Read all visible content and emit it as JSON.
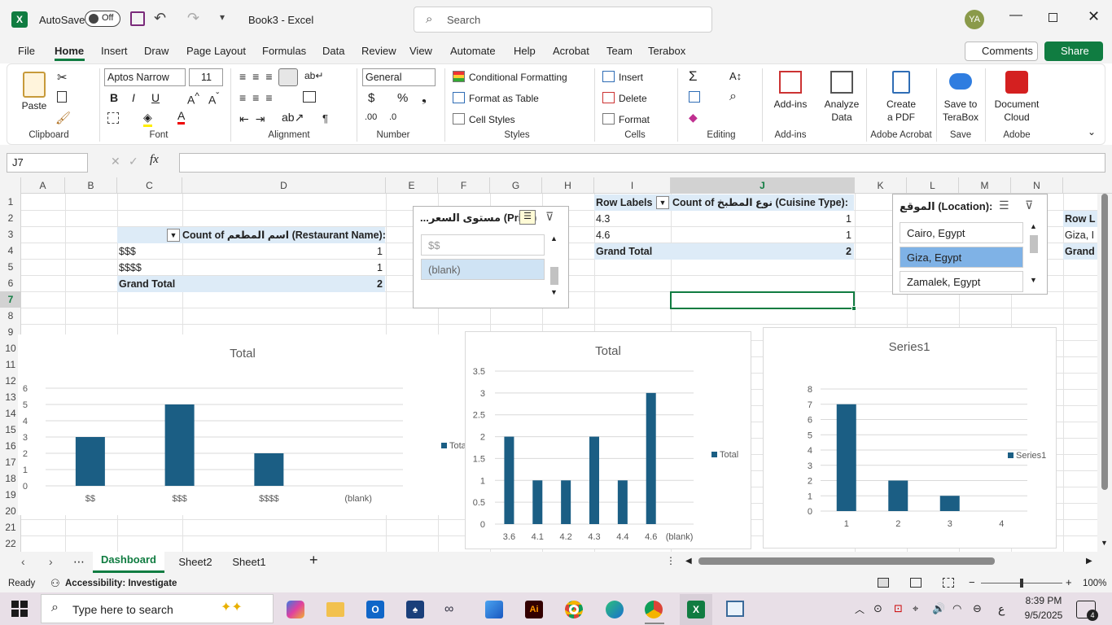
{
  "titlebar": {
    "autosave_label": "AutoSave",
    "autosave_state": "Off",
    "doc_title": "Book3  -  Excel",
    "search_placeholder": "Search",
    "user_initials": "YA"
  },
  "tabs": [
    "File",
    "Home",
    "Insert",
    "Draw",
    "Page Layout",
    "Formulas",
    "Data",
    "Review",
    "View",
    "Automate",
    "Help",
    "Acrobat",
    "Team",
    "Terabox"
  ],
  "ribbon_right": {
    "comments": "Comments",
    "share": "Share"
  },
  "ribbon": {
    "clipboard": {
      "paste": "Paste",
      "group": "Clipboard"
    },
    "font": {
      "name": "Aptos Narrow",
      "size": "11",
      "group": "Font"
    },
    "alignment": {
      "group": "Alignment"
    },
    "number": {
      "format": "General",
      "group": "Number"
    },
    "styles": {
      "cond": "Conditional Formatting",
      "table": "Format as Table",
      "cell": "Cell Styles",
      "group": "Styles"
    },
    "cells": {
      "insert": "Insert",
      "delete": "Delete",
      "format": "Format",
      "group": "Cells"
    },
    "editing": {
      "group": "Editing"
    },
    "addins": {
      "label": "Add-ins",
      "group": "Add-ins"
    },
    "analyze": {
      "l1": "Analyze",
      "l2": "Data"
    },
    "acrobat": {
      "l1": "Create",
      "l2": "a PDF",
      "group": "Adobe Acrobat"
    },
    "terabox": {
      "l1": "Save to",
      "l2": "TeraBox",
      "group": "Save"
    },
    "adobe": {
      "l1": "Document",
      "l2": "Cloud",
      "group": "Adobe"
    }
  },
  "formula_bar": {
    "name_box": "J7",
    "fx": "fx",
    "value": ""
  },
  "columns": [
    "A",
    "B",
    "C",
    "D",
    "E",
    "F",
    "G",
    "H",
    "I",
    "J",
    "K",
    "L",
    "M",
    "N"
  ],
  "rows": [
    "1",
    "2",
    "3",
    "4",
    "5",
    "6",
    "7",
    "8",
    "9",
    "10",
    "11",
    "12",
    "13",
    "14",
    "15",
    "16",
    "17",
    "18",
    "19",
    "20",
    "21",
    "22"
  ],
  "pivot1": {
    "header": "Count of اسم المطعم (Restaurant Name):",
    "rows": [
      {
        "label": "$$$",
        "value": "1"
      },
      {
        "label": "$$$$",
        "value": "1"
      }
    ],
    "total_label": "Grand Total",
    "total_value": "2"
  },
  "pivot2": {
    "row_labels": "Row Labels",
    "header": "Count of نوع المطبخ (Cuisine Type):",
    "rows": [
      {
        "label": "4.3",
        "value": "1"
      },
      {
        "label": "4.6",
        "value": "1"
      }
    ],
    "total_label": "Grand Total",
    "total_value": "2"
  },
  "pivot3": {
    "row_labels": "Row L",
    "row1": "Giza, I",
    "total": "Grand"
  },
  "slicer_price": {
    "title": "...مستوى السعر (Price)",
    "items": [
      "$$",
      "(blank)"
    ]
  },
  "slicer_location": {
    "title": "الموقع (Location):",
    "items": [
      "Cairo, Egypt",
      "Giza, Egypt",
      "Zamalek, Egypt"
    ]
  },
  "chart_data": [
    {
      "type": "bar",
      "title": "Total",
      "categories": [
        "$$",
        "$$$",
        "$$$$",
        "(blank)"
      ],
      "series": [
        {
          "name": "Total",
          "values": [
            3,
            5,
            2,
            0
          ]
        }
      ],
      "ylim": [
        0,
        6
      ],
      "yticks": [
        "0",
        "1",
        "2",
        "3",
        "4",
        "5",
        "6"
      ],
      "legend": "right",
      "color": "#1b5e84"
    },
    {
      "type": "bar",
      "title": "Total",
      "categories": [
        "3.6",
        "4.1",
        "4.2",
        "4.3",
        "4.4",
        "4.6",
        "(blank)"
      ],
      "series": [
        {
          "name": "Total",
          "values": [
            2,
            1,
            1,
            2,
            1,
            3,
            0
          ]
        }
      ],
      "ylim": [
        0,
        3.5
      ],
      "yticks": [
        "0",
        "0.5",
        "1",
        "1.5",
        "2",
        "2.5",
        "3",
        "3.5"
      ],
      "legend": "right",
      "color": "#1b5e84"
    },
    {
      "type": "bar",
      "title": "Series1",
      "categories": [
        "1",
        "2",
        "3",
        "4"
      ],
      "series": [
        {
          "name": "Series1",
          "values": [
            7,
            2,
            1,
            0
          ]
        }
      ],
      "ylim": [
        0,
        8
      ],
      "yticks": [
        "0",
        "1",
        "2",
        "3",
        "4",
        "5",
        "6",
        "7",
        "8"
      ],
      "legend": "right",
      "color": "#1b5e84"
    }
  ],
  "sheets": [
    "Dashboard",
    "Sheet2",
    "Sheet1"
  ],
  "status": {
    "ready": "Ready",
    "accessibility": "Accessibility: Investigate",
    "zoom": "100%"
  },
  "taskbar": {
    "search_placeholder": "Type here to search",
    "time": "8:39 PM",
    "date": "9/5/2025",
    "lang": "ع",
    "notif": "4"
  }
}
